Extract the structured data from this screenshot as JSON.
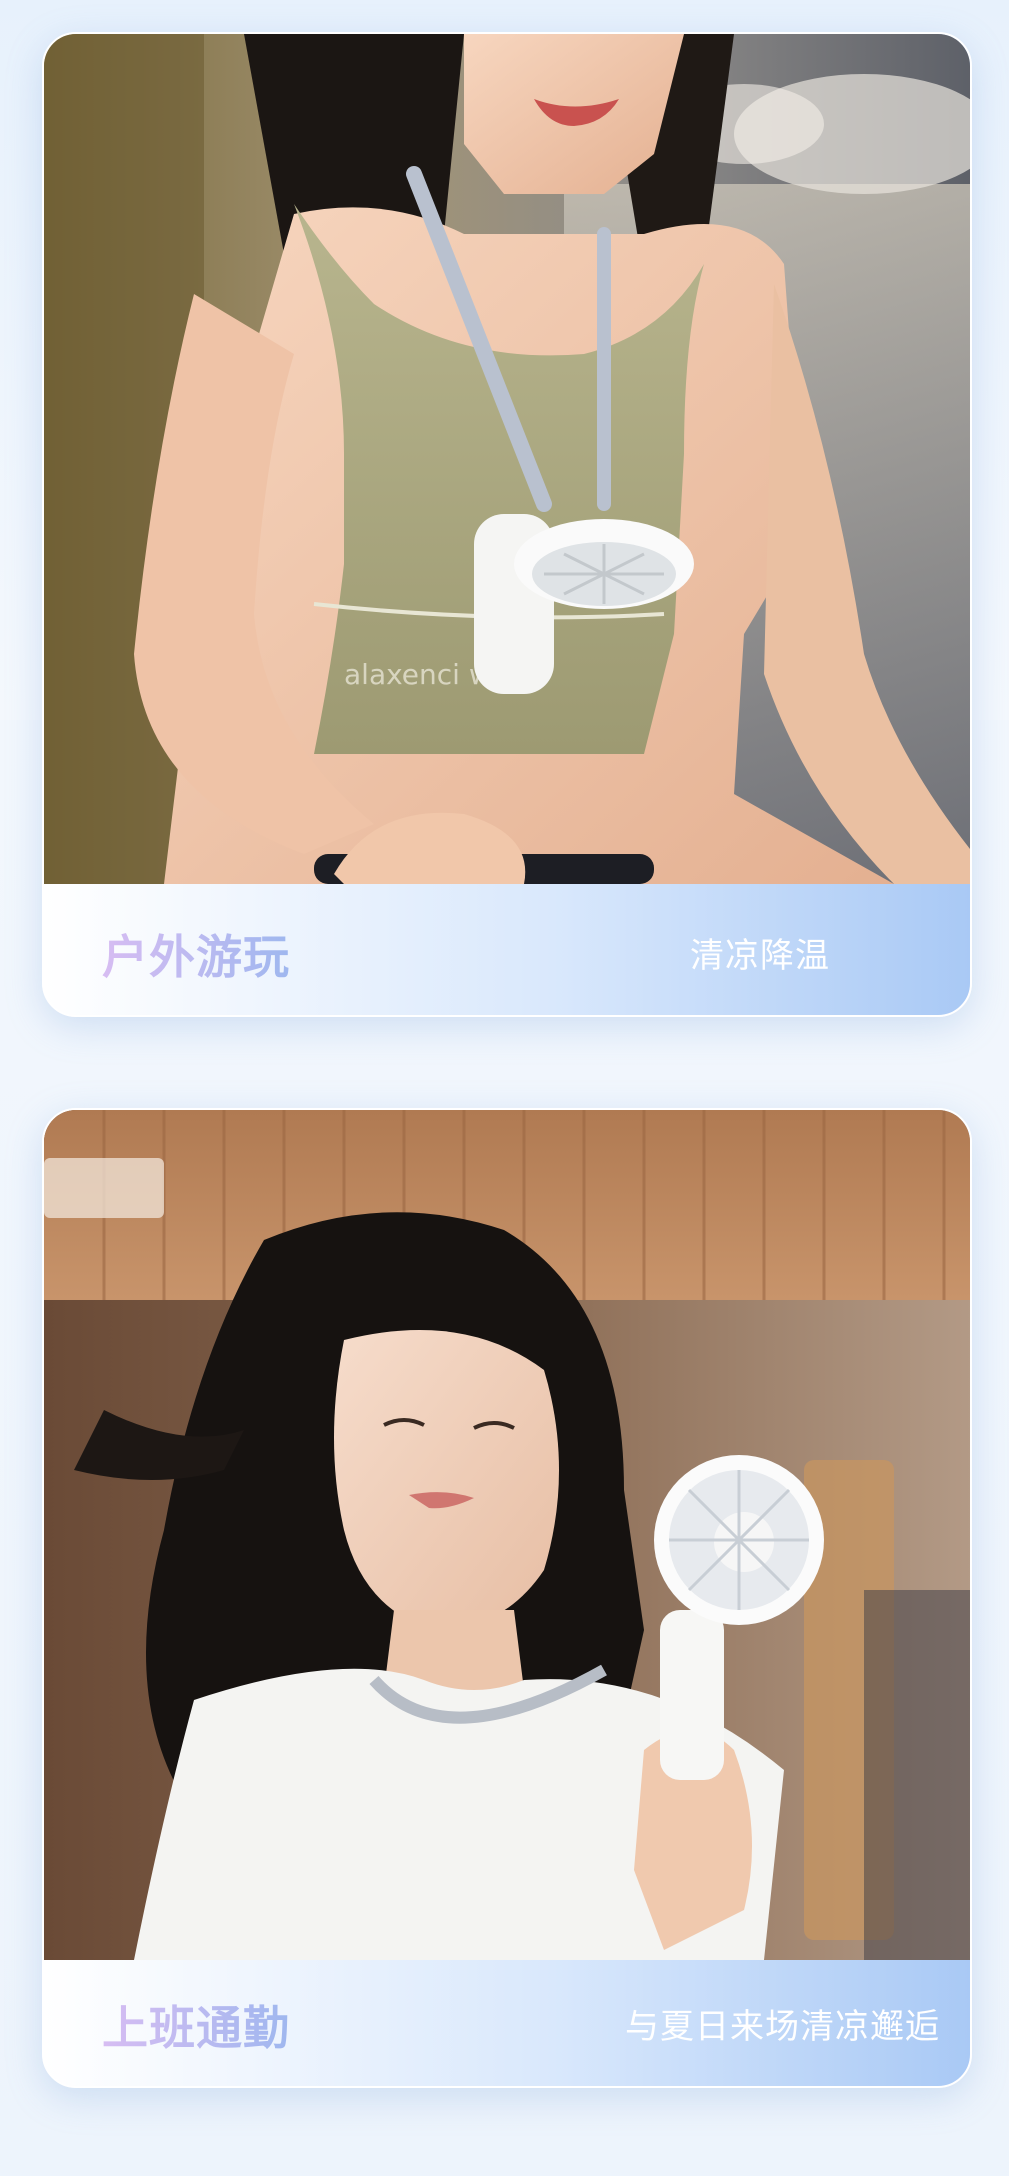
{
  "sections": [
    {
      "title": "户外游玩",
      "subtitle": "清凉降温",
      "image": "woman-with-neck-fan-cycling"
    },
    {
      "title": "上班通勤",
      "subtitle": "与夏日来场清凉邂逅",
      "image": "woman-holding-handheld-fan"
    }
  ],
  "colors": {
    "page_bg": "#f2f7fd",
    "band_gradient_start": "#ffffff",
    "band_gradient_end": "#a9c9f5",
    "title_gradient_start": "#d7bdf2",
    "title_gradient_end": "#9fb7ef",
    "subtitle": "#ffffff"
  }
}
